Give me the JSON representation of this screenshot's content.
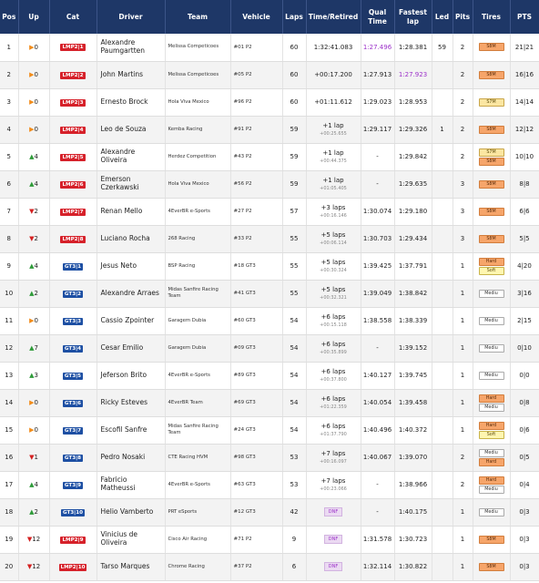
{
  "headers": [
    "Pos",
    "Up",
    "Cat",
    "Driver",
    "Team",
    "Vehicle",
    "Laps",
    "Time/Retired",
    "Qual Time",
    "Fastest lap",
    "Led",
    "Pits",
    "Tires",
    "PTS"
  ],
  "rows": [
    {
      "pos": "1",
      "trend": "same",
      "up": "0",
      "cat_class": "LMP2",
      "cat_num": "1",
      "driver": "Alexandre Paumgartten",
      "team": "Melissa Competicoes",
      "vehicle": "#01 P2",
      "laps": "60",
      "time": "1:32:41.083",
      "time_sub": "",
      "qual": "1:27.496",
      "qual_purple": true,
      "fastest": "1:28.381",
      "fastest_purple": false,
      "led": "59",
      "pits": "2",
      "tires": [
        {
          "label": "S8M",
          "style": "orange"
        }
      ],
      "pts": "21|21"
    },
    {
      "pos": "2",
      "trend": "same",
      "up": "0",
      "cat_class": "LMP2",
      "cat_num": "2",
      "driver": "John Martins",
      "team": "Melissa Competicoes",
      "vehicle": "#05 P2",
      "laps": "60",
      "time": "+00:17.200",
      "time_sub": "",
      "qual": "1:27.913",
      "qual_purple": false,
      "fastest": "1:27.923",
      "fastest_purple": true,
      "led": "",
      "pits": "2",
      "tires": [
        {
          "label": "S8M",
          "style": "orange"
        }
      ],
      "pts": "16|16"
    },
    {
      "pos": "3",
      "trend": "same",
      "up": "0",
      "cat_class": "LMP2",
      "cat_num": "3",
      "driver": "Ernesto Brock",
      "team": "Hola Viva Mexico",
      "vehicle": "#96 P2",
      "laps": "60",
      "time": "+01:11.612",
      "time_sub": "",
      "qual": "1:29.023",
      "qual_purple": false,
      "fastest": "1:28.953",
      "fastest_purple": false,
      "led": "",
      "pits": "2",
      "tires": [
        {
          "label": "S7M",
          "style": "yellow"
        }
      ],
      "pts": "14|14"
    },
    {
      "pos": "4",
      "trend": "same",
      "up": "0",
      "cat_class": "LMP2",
      "cat_num": "4",
      "driver": "Leo de Souza",
      "team": "Kemba Racing",
      "vehicle": "#91 P2",
      "laps": "59",
      "time": "+1 lap",
      "time_sub": "+00:25.655",
      "qual": "1:29.117",
      "qual_purple": false,
      "fastest": "1:29.326",
      "fastest_purple": false,
      "led": "1",
      "pits": "2",
      "tires": [
        {
          "label": "S8M",
          "style": "orange"
        }
      ],
      "pts": "12|12"
    },
    {
      "pos": "5",
      "trend": "up",
      "up": "4",
      "cat_class": "LMP2",
      "cat_num": "5",
      "driver": "Alexandre Oliveira",
      "team": "Herdez Competition",
      "vehicle": "#43 P2",
      "laps": "59",
      "time": "+1 lap",
      "time_sub": "+00:44.375",
      "qual": "-",
      "qual_purple": false,
      "fastest": "1:29.842",
      "fastest_purple": false,
      "led": "",
      "pits": "2",
      "tires": [
        {
          "label": "S7M",
          "style": "yellow"
        },
        {
          "label": "S8M",
          "style": "orange"
        }
      ],
      "pts": "10|10"
    },
    {
      "pos": "6",
      "trend": "up",
      "up": "4",
      "cat_class": "LMP2",
      "cat_num": "6",
      "driver": "Emerson Czerkawski",
      "team": "Hola Viva Mexico",
      "vehicle": "#56 P2",
      "laps": "59",
      "time": "+1 lap",
      "time_sub": "+01:05.405",
      "qual": "-",
      "qual_purple": false,
      "fastest": "1:29.635",
      "fastest_purple": false,
      "led": "",
      "pits": "3",
      "tires": [
        {
          "label": "S8M",
          "style": "orange"
        }
      ],
      "pts": "8|8"
    },
    {
      "pos": "7",
      "trend": "down",
      "up": "2",
      "cat_class": "LMP2",
      "cat_num": "7",
      "driver": "Renan Mello",
      "team": "4EverBR e-Sports",
      "vehicle": "#27 P2",
      "laps": "57",
      "time": "+3 laps",
      "time_sub": "+00:16.146",
      "qual": "1:30.074",
      "qual_purple": false,
      "fastest": "1:29.180",
      "fastest_purple": false,
      "led": "",
      "pits": "3",
      "tires": [
        {
          "label": "S8M",
          "style": "orange"
        }
      ],
      "pts": "6|6"
    },
    {
      "pos": "8",
      "trend": "down",
      "up": "2",
      "cat_class": "LMP2",
      "cat_num": "8",
      "driver": "Luciano Rocha",
      "team": "268 Racing",
      "vehicle": "#33 P2",
      "laps": "55",
      "time": "+5 laps",
      "time_sub": "+00:06.114",
      "qual": "1:30.703",
      "qual_purple": false,
      "fastest": "1:29.434",
      "fastest_purple": false,
      "led": "",
      "pits": "3",
      "tires": [
        {
          "label": "S8M",
          "style": "orange"
        }
      ],
      "pts": "5|5"
    },
    {
      "pos": "9",
      "trend": "up",
      "up": "4",
      "cat_class": "GT3",
      "cat_num": "1",
      "driver": "Jesus Neto",
      "team": "BSP Racing",
      "vehicle": "#18 GT3",
      "laps": "55",
      "time": "+5 laps",
      "time_sub": "+00:30.324",
      "qual": "1:39.425",
      "qual_purple": false,
      "fastest": "1:37.791",
      "fastest_purple": false,
      "led": "",
      "pits": "1",
      "tires": [
        {
          "label": "Hard",
          "style": "orange"
        },
        {
          "label": "Soft",
          "style": "yellowsoft"
        }
      ],
      "pts": "4|20"
    },
    {
      "pos": "10",
      "trend": "up",
      "up": "2",
      "cat_class": "GT3",
      "cat_num": "2",
      "driver": "Alexandre Arraes",
      "team": "Midas Sanfire Racing Team",
      "vehicle": "#41 GT3",
      "laps": "55",
      "time": "+5 laps",
      "time_sub": "+00:32.321",
      "qual": "1:39.049",
      "qual_purple": false,
      "fastest": "1:38.842",
      "fastest_purple": false,
      "led": "",
      "pits": "1",
      "tires": [
        {
          "label": "Mediu",
          "style": "white"
        }
      ],
      "pts": "3|16"
    },
    {
      "pos": "11",
      "trend": "same",
      "up": "0",
      "cat_class": "GT3",
      "cat_num": "3",
      "driver": "Cassio Zpointer",
      "team": "Garagem Dubia",
      "vehicle": "#60 GT3",
      "laps": "54",
      "time": "+6 laps",
      "time_sub": "+00:15.118",
      "qual": "1:38.558",
      "qual_purple": false,
      "fastest": "1:38.339",
      "fastest_purple": false,
      "led": "",
      "pits": "1",
      "tires": [
        {
          "label": "Mediu",
          "style": "white"
        }
      ],
      "pts": "2|15"
    },
    {
      "pos": "12",
      "trend": "up",
      "up": "7",
      "cat_class": "GT3",
      "cat_num": "4",
      "driver": "Cesar Emilio",
      "team": "Garagem Dubia",
      "vehicle": "#09 GT3",
      "laps": "54",
      "time": "+6 laps",
      "time_sub": "+00:35.899",
      "qual": "-",
      "qual_purple": false,
      "fastest": "1:39.152",
      "fastest_purple": false,
      "led": "",
      "pits": "1",
      "tires": [
        {
          "label": "Mediu",
          "style": "white"
        }
      ],
      "pts": "0|10"
    },
    {
      "pos": "13",
      "trend": "up",
      "up": "3",
      "cat_class": "GT3",
      "cat_num": "5",
      "driver": "Jeferson Brito",
      "team": "4EverBR e-Sports",
      "vehicle": "#89 GT3",
      "laps": "54",
      "time": "+6 laps",
      "time_sub": "+00:37.800",
      "qual": "1:40.127",
      "qual_purple": false,
      "fastest": "1:39.745",
      "fastest_purple": false,
      "led": "",
      "pits": "1",
      "tires": [
        {
          "label": "Mediu",
          "style": "white"
        }
      ],
      "pts": "0|0"
    },
    {
      "pos": "14",
      "trend": "same",
      "up": "0",
      "cat_class": "GT3",
      "cat_num": "6",
      "driver": "Ricky Esteves",
      "team": "4EverBR Team",
      "vehicle": "#69 GT3",
      "laps": "54",
      "time": "+6 laps",
      "time_sub": "+01:22.359",
      "qual": "1:40.054",
      "qual_purple": false,
      "fastest": "1:39.458",
      "fastest_purple": false,
      "led": "",
      "pits": "1",
      "tires": [
        {
          "label": "Hard",
          "style": "orange"
        },
        {
          "label": "Mediu",
          "style": "white"
        }
      ],
      "pts": "0|8"
    },
    {
      "pos": "15",
      "trend": "same",
      "up": "0",
      "cat_class": "GT3",
      "cat_num": "7",
      "driver": "Escofil Sanfre",
      "team": "Midas Sanfire Racing Team",
      "vehicle": "#24 GT3",
      "laps": "54",
      "time": "+6 laps",
      "time_sub": "+01:37.790",
      "qual": "1:40.496",
      "qual_purple": false,
      "fastest": "1:40.372",
      "fastest_purple": false,
      "led": "",
      "pits": "1",
      "tires": [
        {
          "label": "Hard",
          "style": "orange"
        },
        {
          "label": "Soft",
          "style": "yellowsoft"
        }
      ],
      "pts": "0|6"
    },
    {
      "pos": "16",
      "trend": "down",
      "up": "1",
      "cat_class": "GT3",
      "cat_num": "8",
      "driver": "Pedro Nosaki",
      "team": "CTE Racing HVM",
      "vehicle": "#98 GT3",
      "laps": "53",
      "time": "+7 laps",
      "time_sub": "+00:16.097",
      "qual": "1:40.067",
      "qual_purple": false,
      "fastest": "1:39.070",
      "fastest_purple": false,
      "led": "",
      "pits": "2",
      "tires": [
        {
          "label": "Mediu",
          "style": "white"
        },
        {
          "label": "Hard",
          "style": "orange"
        }
      ],
      "pts": "0|5"
    },
    {
      "pos": "17",
      "trend": "up",
      "up": "4",
      "cat_class": "GT3",
      "cat_num": "9",
      "driver": "Fabricio Matheussi",
      "team": "4EverBR e-Sports",
      "vehicle": "#63 GT3",
      "laps": "53",
      "time": "+7 laps",
      "time_sub": "+00:23.066",
      "qual": "-",
      "qual_purple": false,
      "fastest": "1:38.966",
      "fastest_purple": false,
      "led": "",
      "pits": "2",
      "tires": [
        {
          "label": "Hard",
          "style": "orange"
        },
        {
          "label": "Mediu",
          "style": "white"
        }
      ],
      "pts": "0|4"
    },
    {
      "pos": "18",
      "trend": "up",
      "up": "2",
      "cat_class": "GT3",
      "cat_num": "10",
      "driver": "Helio Vamberto",
      "team": "PRT eSports",
      "vehicle": "#12 GT3",
      "laps": "42",
      "time": "DNF",
      "time_sub": "",
      "time_dnf": true,
      "qual": "-",
      "qual_purple": false,
      "fastest": "1:40.175",
      "fastest_purple": false,
      "led": "",
      "pits": "1",
      "tires": [
        {
          "label": "Mediu",
          "style": "white"
        }
      ],
      "pts": "0|3"
    },
    {
      "pos": "19",
      "trend": "down",
      "up": "12",
      "cat_class": "LMP2",
      "cat_num": "9",
      "driver": "Vinicius de Oliveira",
      "team": "Cisco Air Racing",
      "vehicle": "#71 P2",
      "laps": "9",
      "time": "DNF",
      "time_sub": "",
      "time_dnf": true,
      "qual": "1:31.578",
      "qual_purple": false,
      "fastest": "1:30.723",
      "fastest_purple": false,
      "led": "",
      "pits": "1",
      "tires": [
        {
          "label": "S8M",
          "style": "orange"
        }
      ],
      "pts": "0|3"
    },
    {
      "pos": "20",
      "trend": "down",
      "up": "12",
      "cat_class": "LMP2",
      "cat_num": "10",
      "driver": "Tarso Marques",
      "team": "Chrome Racing",
      "vehicle": "#37 P2",
      "laps": "6",
      "time": "DNF",
      "time_sub": "",
      "time_dnf": true,
      "qual": "1:32.114",
      "qual_purple": false,
      "fastest": "1:30.822",
      "fastest_purple": false,
      "led": "",
      "pits": "1",
      "tires": [
        {
          "label": "S8M",
          "style": "orange"
        }
      ],
      "pts": "0|3"
    }
  ],
  "colors": {
    "header_bg": "#1e3767",
    "lmp2": "#d6212a",
    "gt3": "#1d4fa3",
    "up": "#2e9b39",
    "down": "#d42020",
    "same": "#f28c1a",
    "best": "#9b2fc9"
  }
}
